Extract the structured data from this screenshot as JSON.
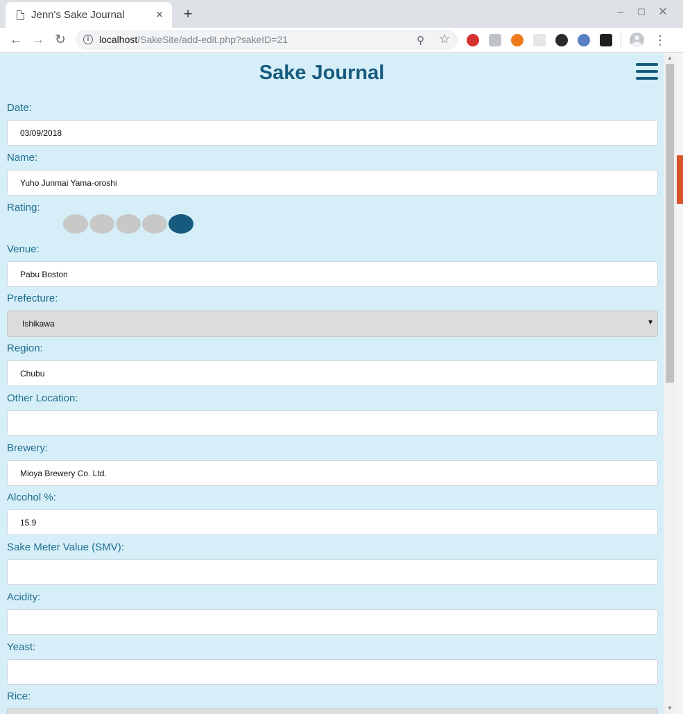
{
  "browser": {
    "tab_title": "Jenn's Sake Journal",
    "url_host": "localhost",
    "url_path": "/SakeSite/add-edit.php?sakeID=21",
    "extensions": [
      "abp-icon",
      "ghostery-icon",
      "firefox-icon",
      "grid-icon",
      "panda-icon",
      "info-icon",
      "gimp-icon"
    ]
  },
  "page": {
    "title": "Sake Journal"
  },
  "form": {
    "date": {
      "label": "Date:",
      "value": "03/09/2018"
    },
    "name": {
      "label": "Name:",
      "value": "Yuho Junmai Yama-oroshi"
    },
    "rating": {
      "label": "Rating:",
      "value": 5,
      "max": 5,
      "filled_color": "#165b7d",
      "empty_color": "#c8c8c8"
    },
    "venue": {
      "label": "Venue:",
      "value": "Pabu Boston"
    },
    "prefecture": {
      "label": "Prefecture:",
      "value": "Ishikawa"
    },
    "region": {
      "label": "Region:",
      "value": "Chubu"
    },
    "other_location": {
      "label": "Other Location:",
      "value": ""
    },
    "brewery": {
      "label": "Brewery:",
      "value": "Mioya Brewery Co. Ltd."
    },
    "alcohol": {
      "label": "Alcohol %:",
      "value": "15.9"
    },
    "smv": {
      "label": "Sake Meter Value (SMV):",
      "value": ""
    },
    "acidity": {
      "label": "Acidity:",
      "value": ""
    },
    "yeast": {
      "label": "Yeast:",
      "value": ""
    },
    "rice": {
      "label": "Rice:"
    }
  },
  "colors": {
    "page_bg": "#d6eef8",
    "accent": "#165b7d",
    "label": "#1e6d90"
  }
}
